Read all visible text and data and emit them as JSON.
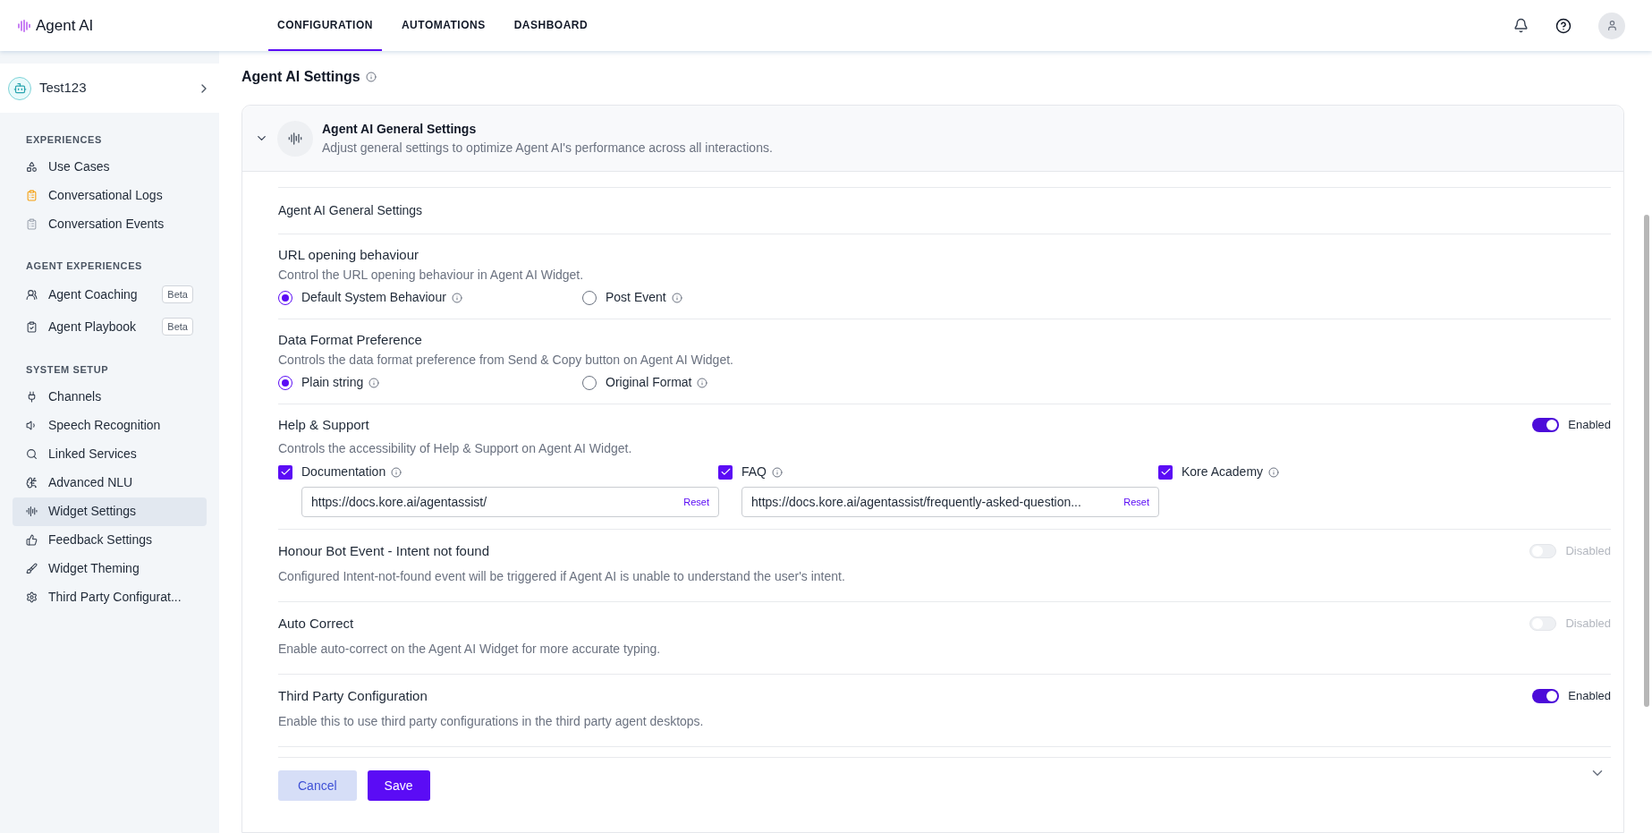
{
  "app": {
    "name": "Agent AI"
  },
  "nav_tabs": [
    {
      "label": "CONFIGURATION",
      "selected": true
    },
    {
      "label": "AUTOMATIONS",
      "selected": false
    },
    {
      "label": "DASHBOARD",
      "selected": false
    }
  ],
  "sidebar": {
    "bot": {
      "name": "Test123"
    },
    "sections": [
      {
        "heading": "EXPERIENCES",
        "items": [
          {
            "label": "Use Cases",
            "selected": false
          },
          {
            "label": "Conversational Logs",
            "selected": false
          },
          {
            "label": "Conversation Events",
            "selected": false
          }
        ]
      },
      {
        "heading": "AGENT EXPERIENCES",
        "items": [
          {
            "label": "Agent Coaching",
            "badge": "Beta",
            "selected": false
          },
          {
            "label": "Agent Playbook",
            "badge": "Beta",
            "selected": false
          }
        ]
      },
      {
        "heading": "SYSTEM SETUP",
        "items": [
          {
            "label": "Channels",
            "selected": false
          },
          {
            "label": "Speech Recognition",
            "selected": false
          },
          {
            "label": "Linked Services",
            "selected": false
          },
          {
            "label": "Advanced NLU",
            "selected": false
          },
          {
            "label": "Widget Settings",
            "selected": true
          },
          {
            "label": "Feedback Settings",
            "selected": false
          },
          {
            "label": "Widget Theming",
            "selected": false
          },
          {
            "label": "Third Party Configurat...",
            "selected": false
          }
        ]
      }
    ]
  },
  "page": {
    "title": "Agent AI Settings"
  },
  "panel": {
    "title": "Agent AI General Settings",
    "description": "Adjust general settings to optimize Agent AI's performance across all interactions.",
    "expanded": true,
    "subheading": "Agent AI General Settings",
    "settings": [
      {
        "kind": "radio",
        "title": "URL opening behaviour",
        "description": "Control the URL opening behaviour in Agent AI Widget.",
        "options": [
          {
            "label": "Default System Behaviour",
            "selected": true
          },
          {
            "label": "Post Event",
            "selected": false
          }
        ]
      },
      {
        "kind": "radio",
        "title": "Data Format Preference",
        "description": "Controls the data format preference from Send & Copy button on Agent AI Widget.",
        "options": [
          {
            "label": "Plain string",
            "selected": true
          },
          {
            "label": "Original Format",
            "selected": false
          }
        ]
      },
      {
        "kind": "links",
        "title": "Help & Support",
        "description": "Controls the accessibility of Help & Support on Agent AI Widget.",
        "toggle": {
          "on": true,
          "label": "Enabled"
        },
        "links": [
          {
            "label": "Documentation",
            "checked": true,
            "url": "https://docs.kore.ai/agentassist/",
            "action": "Reset"
          },
          {
            "label": "FAQ",
            "checked": true,
            "url": "https://docs.kore.ai/agentassist/frequently-asked-question...",
            "action": "Reset"
          },
          {
            "label": "Kore Academy",
            "checked": true
          }
        ]
      },
      {
        "kind": "toggle",
        "title": "Honour Bot Event - Intent not found",
        "description": "Configured Intent-not-found event will be triggered if Agent AI is unable to understand the user's intent.",
        "toggle": {
          "on": false,
          "label": "Disabled"
        }
      },
      {
        "kind": "toggle",
        "title": "Auto Correct",
        "description": "Enable auto-correct on the Agent AI Widget for more accurate typing.",
        "toggle": {
          "on": false,
          "label": "Disabled"
        }
      },
      {
        "kind": "toggle",
        "title": "Third Party Configuration",
        "description": "Enable this to use third party configurations in the third party agent desktops.",
        "toggle": {
          "on": true,
          "label": "Enabled"
        }
      }
    ]
  },
  "buttons": [
    {
      "label": "Cancel",
      "kind": "secondary"
    },
    {
      "label": "Save",
      "kind": "primary"
    }
  ]
}
